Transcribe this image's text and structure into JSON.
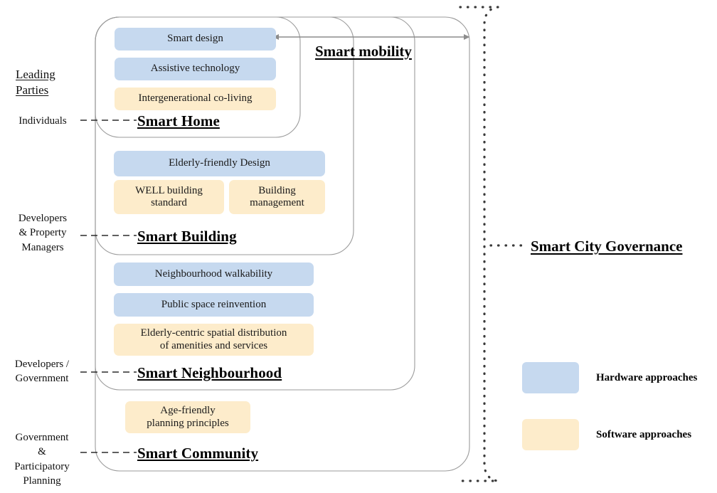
{
  "columns": {
    "leading_parties_heading_line1": "Leading",
    "leading_parties_heading_line2": "Parties"
  },
  "parties": [
    {
      "id": "individuals",
      "label": "Individuals"
    },
    {
      "id": "developers-property-managers",
      "label": "Developers\n& Property\nManagers"
    },
    {
      "id": "developers-government",
      "label": "Developers /\nGovernment"
    },
    {
      "id": "government-participatory-planning",
      "label": "Government\n&\nParticipatory\nPlanning"
    }
  ],
  "tiers": [
    {
      "id": "smart-home",
      "title": "Smart Home",
      "items": [
        {
          "label": "Smart design",
          "kind": "hardware"
        },
        {
          "label": "Assistive technology",
          "kind": "hardware"
        },
        {
          "label": "Intergenerational co-living",
          "kind": "software"
        }
      ]
    },
    {
      "id": "smart-building",
      "title": "Smart Building",
      "items": [
        {
          "label": "Elderly-friendly Design",
          "kind": "hardware"
        },
        {
          "label": "WELL building standard",
          "kind": "software"
        },
        {
          "label": "Building management",
          "kind": "software"
        }
      ]
    },
    {
      "id": "smart-neighbourhood",
      "title": "Smart Neighbourhood",
      "items": [
        {
          "label": "Neighbourhood walkability",
          "kind": "hardware"
        },
        {
          "label": "Public space reinvention",
          "kind": "hardware"
        },
        {
          "label": "Elderly-centric spatial distribution of amenities and services",
          "kind": "software"
        }
      ]
    },
    {
      "id": "smart-community",
      "title": "Smart Community",
      "items": [
        {
          "label": "Age-friendly planning principles",
          "kind": "software"
        }
      ]
    }
  ],
  "cross_cutting": {
    "mobility_label": "Smart mobility",
    "governance_label": "Smart City Governance"
  },
  "legend": {
    "items": [
      {
        "label": "Hardware approaches",
        "color": "#c6d9ef",
        "icon": "hardware-swatch"
      },
      {
        "label": "Software approaches",
        "color": "#fdeccb",
        "icon": "software-swatch"
      }
    ]
  },
  "colors": {
    "hardware": "#c6d9ef",
    "software": "#fdeccb",
    "container_stroke": "#9b9b9b",
    "arrow": "#8c8c8c",
    "dotted": "#3a3a3a",
    "dashed_connector": "#2b2b2b"
  },
  "pill_texts": {
    "smart_design": "Smart design",
    "assistive_technology": "Assistive technology",
    "intergenerational_coliving": "Intergenerational co-living",
    "elderly_friendly_design": "Elderly-friendly Design",
    "well_building_standard": "WELL building\nstandard",
    "building_management": "Building\nmanagement",
    "neighbourhood_walkability": "Neighbourhood walkability",
    "public_space_reinvention": "Public space reinvention",
    "elderly_centric_distribution": "Elderly-centric spatial distribution\nof amenities and services",
    "age_friendly_planning": "Age-friendly\nplanning principles"
  }
}
